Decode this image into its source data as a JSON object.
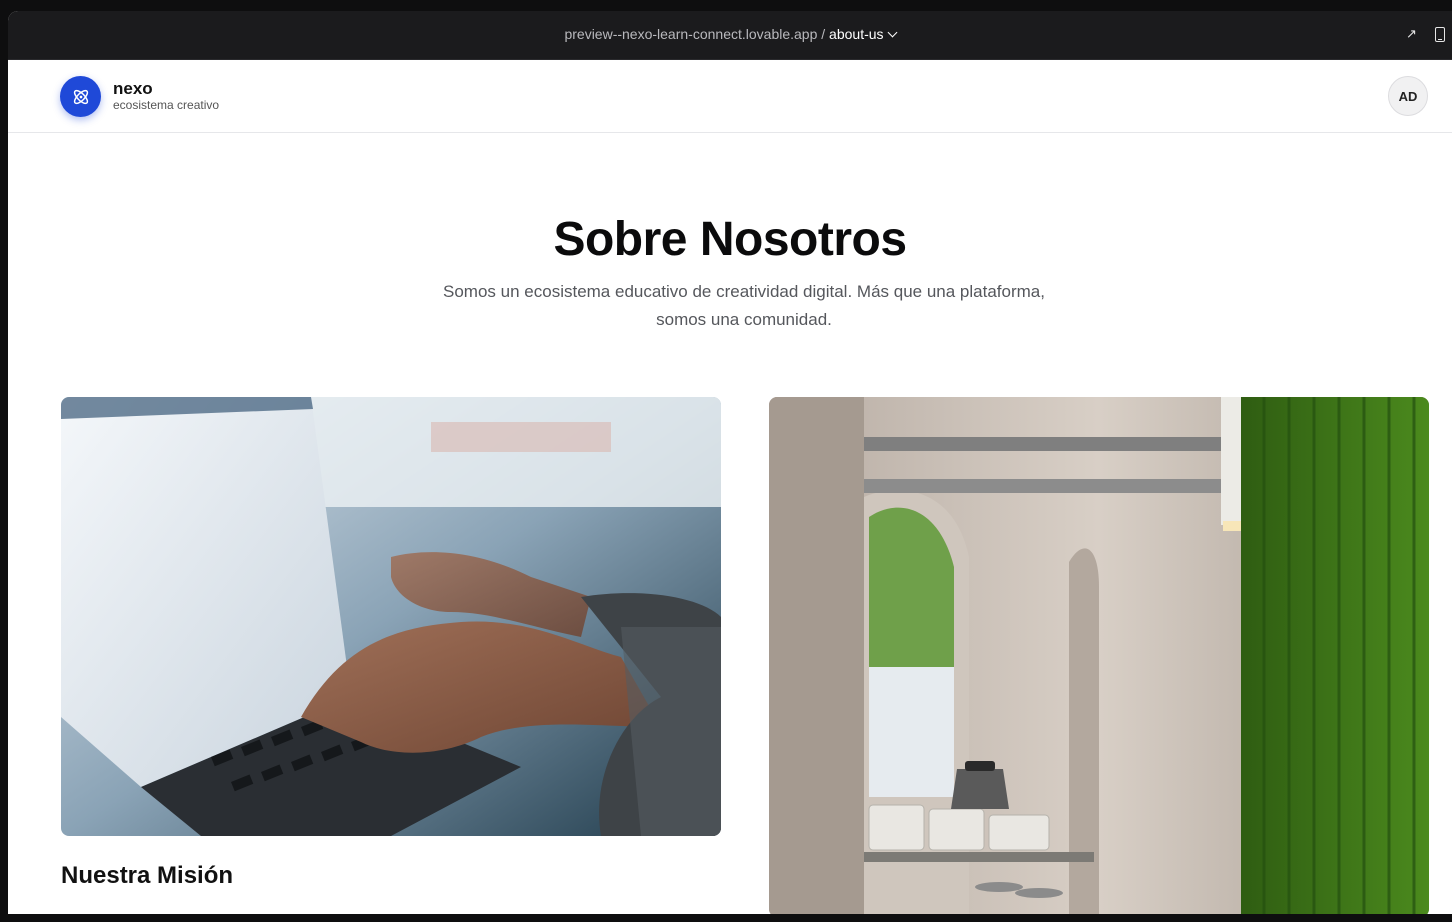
{
  "preview_bar": {
    "host": "preview--nexo-learn-connect.lovable.app",
    "separator": " / ",
    "route": "about-us",
    "open_icon": "external-link-arrow",
    "device_icon": "mobile-device"
  },
  "header": {
    "logo_icon": "atom-icon",
    "brand_name": "nexo",
    "brand_tagline": "ecosistema creativo",
    "avatar_initials": "AD"
  },
  "hero": {
    "title": "Sobre Nosotros",
    "subtitle": "Somos un ecosistema educativo de creatividad digital. Más que una plataforma, somos una comunidad."
  },
  "images": {
    "left": "laptop-typing-photo",
    "right": "cafe-interior-photo"
  },
  "mission": {
    "title": "Nuestra Misión"
  },
  "colors": {
    "brand": "#1f49d8",
    "preview_bar": "#1b1b1d"
  }
}
